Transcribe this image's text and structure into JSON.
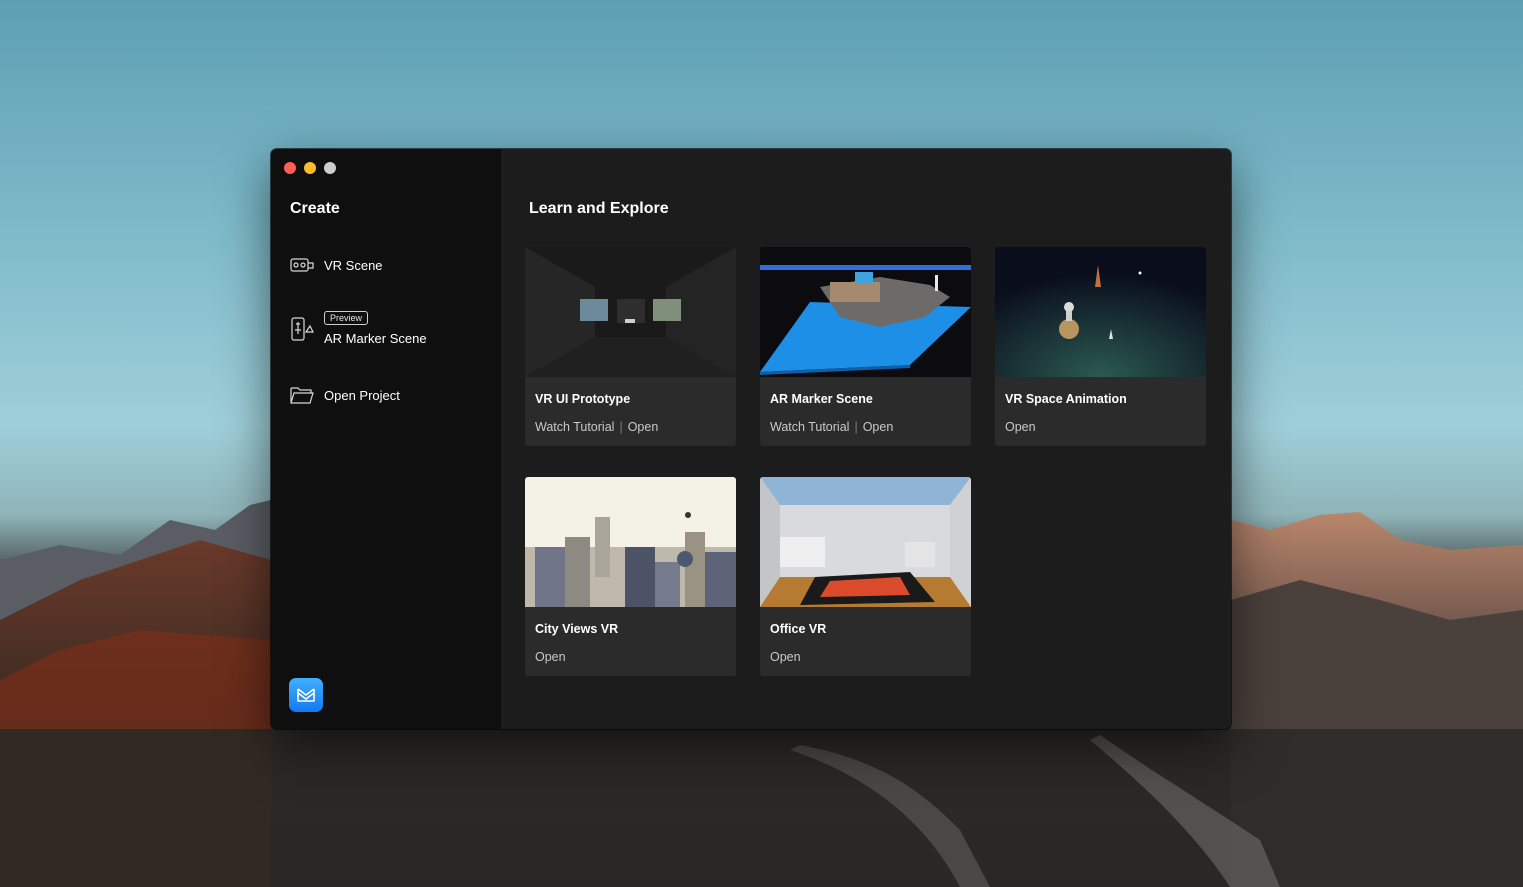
{
  "window": {
    "controls": [
      "close",
      "minimize",
      "zoom"
    ]
  },
  "sidebar": {
    "title": "Create",
    "items": [
      {
        "label": "VR Scene",
        "icon": "vr-headset-icon"
      },
      {
        "label": "AR Marker Scene",
        "badge": "Preview",
        "icon": "ar-phone-icon"
      },
      {
        "label": "Open Project",
        "icon": "folder-icon"
      }
    ],
    "app_icon": "app-logo-icon"
  },
  "main": {
    "title": "Learn and Explore",
    "cards": [
      {
        "title": "VR UI Prototype",
        "link1": "Watch Tutorial",
        "link2": "Open"
      },
      {
        "title": "AR Marker Scene",
        "link1": "Watch Tutorial",
        "link2": "Open"
      },
      {
        "title": "VR Space Animation",
        "link1": "Open"
      },
      {
        "title": "City Views VR",
        "link1": "Open"
      },
      {
        "title": "Office VR",
        "link1": "Open"
      }
    ]
  },
  "colors": {
    "accent": "#1478f2",
    "window_bg": "#1c1c1c",
    "sidebar_bg": "#0f0f0f",
    "card_bg": "#2b2b2b"
  }
}
